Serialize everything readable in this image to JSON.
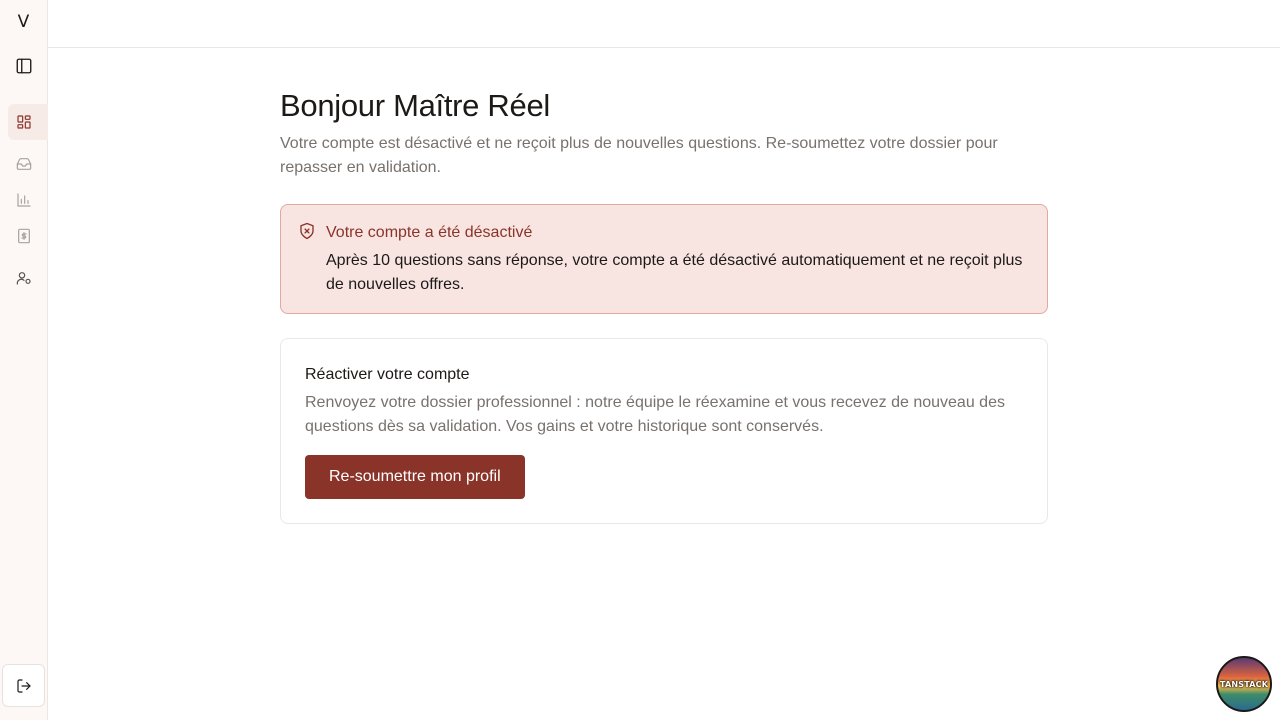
{
  "sidebar": {
    "logo": "V",
    "toggle_icon": "sidebar-toggle-icon",
    "items": [
      {
        "icon": "dashboard-icon",
        "active": true
      },
      {
        "icon": "inbox-icon",
        "active": false
      },
      {
        "icon": "bar-chart-icon",
        "active": false
      },
      {
        "icon": "dollar-icon",
        "active": false
      },
      {
        "icon": "user-settings-icon",
        "active": false
      }
    ],
    "logout_icon": "logout-icon"
  },
  "main": {
    "title": "Bonjour Maître Réel",
    "subtitle": "Votre compte est désactivé et ne reçoit plus de nouvelles questions. Re-soumettez votre dossier pour repasser en validation."
  },
  "alert": {
    "icon": "shield-x-icon",
    "title": "Votre compte a été désactivé",
    "body": "Après 10 questions sans réponse, votre compte a été désactivé automatiquement et ne reçoit plus de nouvelles offres."
  },
  "card": {
    "title": "Réactiver votre compte",
    "body": "Renvoyez votre dossier professionnel : notre équipe le réexamine et vous recevez de nouveau des questions dès sa validation. Vos gains et votre historique sont conservés.",
    "button_label": "Re-soumettre mon profil"
  },
  "devtools": {
    "label": "TANSTACK"
  },
  "colors": {
    "accent": "#8a3429",
    "alert_bg": "#f8e5e2",
    "muted_text": "#78716c"
  }
}
